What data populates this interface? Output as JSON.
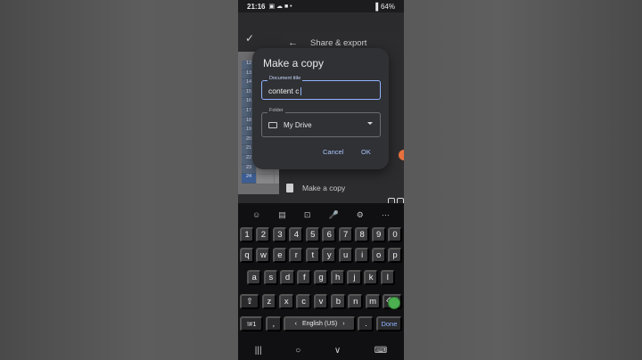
{
  "status_bar": {
    "time": "21:16",
    "icons": "▣ ☁ ■ •",
    "signal": "▐",
    "battery": "64%"
  },
  "app": {
    "check_icon": "check-icon",
    "row_numbers": [
      "12",
      "13",
      "14",
      "15",
      "16",
      "17",
      "18",
      "19",
      "20",
      "21",
      "22",
      "23",
      "24"
    ]
  },
  "share_panel": {
    "title": "Share & export",
    "make_copy_label": "Make a copy"
  },
  "dialog": {
    "title": "Make a copy",
    "doc_title_label": "Document title",
    "doc_title_value": "content c",
    "folder_label": "Folder",
    "folder_value": "My Drive",
    "cancel_label": "Cancel",
    "ok_label": "OK"
  },
  "keyboard": {
    "suggestions": [
      "☺",
      "▤",
      "⊡",
      "🎤",
      "⚙",
      "⋯"
    ],
    "row_numbers": [
      "1",
      "2",
      "3",
      "4",
      "5",
      "6",
      "7",
      "8",
      "9",
      "0"
    ],
    "row_1": [
      "q",
      "w",
      "e",
      "r",
      "t",
      "y",
      "u",
      "i",
      "o",
      "p"
    ],
    "row_2": [
      "a",
      "s",
      "d",
      "f",
      "g",
      "h",
      "j",
      "k",
      "l"
    ],
    "row_3": [
      "z",
      "x",
      "c",
      "v",
      "b",
      "n",
      "m"
    ],
    "shift_label": "⇧",
    "backspace_label": "⌫",
    "symbols_label": "!#1",
    "comma_label": ",",
    "space_label": "English (US)",
    "space_left_arrow": "‹",
    "space_right_arrow": "›",
    "period_label": ".",
    "done_label": "Done"
  },
  "nav": {
    "recents": "|||",
    "home": "○",
    "back": "∨",
    "keyboard": "⌨"
  },
  "colors": {
    "accent": "#8fb3ff",
    "dialog_bg": "#303134",
    "keyboard_bg": "#101012"
  }
}
